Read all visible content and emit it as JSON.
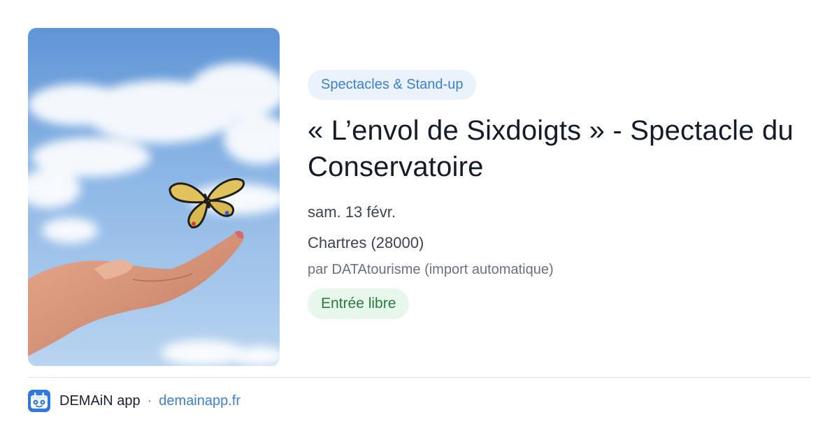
{
  "event": {
    "category": "Spectacles & Stand-up",
    "title": "« L’envol de Sixdoigts » - Spectacle du Conservatoire",
    "date": "sam. 13 févr.",
    "location": "Chartres (28000)",
    "source": "par DATAtourisme (import automatique)",
    "price": "Entrée libre"
  },
  "footer": {
    "app_name": "DEMAiN app",
    "separator": "·",
    "url": "demainapp.fr"
  },
  "colors": {
    "accent": "#3b7fd8",
    "category_bg": "#eaf2fc",
    "price_bg": "#e8f7ec",
    "price_text": "#2a7a3e"
  },
  "icons": {
    "app_logo": "demain-app-logo-icon"
  }
}
